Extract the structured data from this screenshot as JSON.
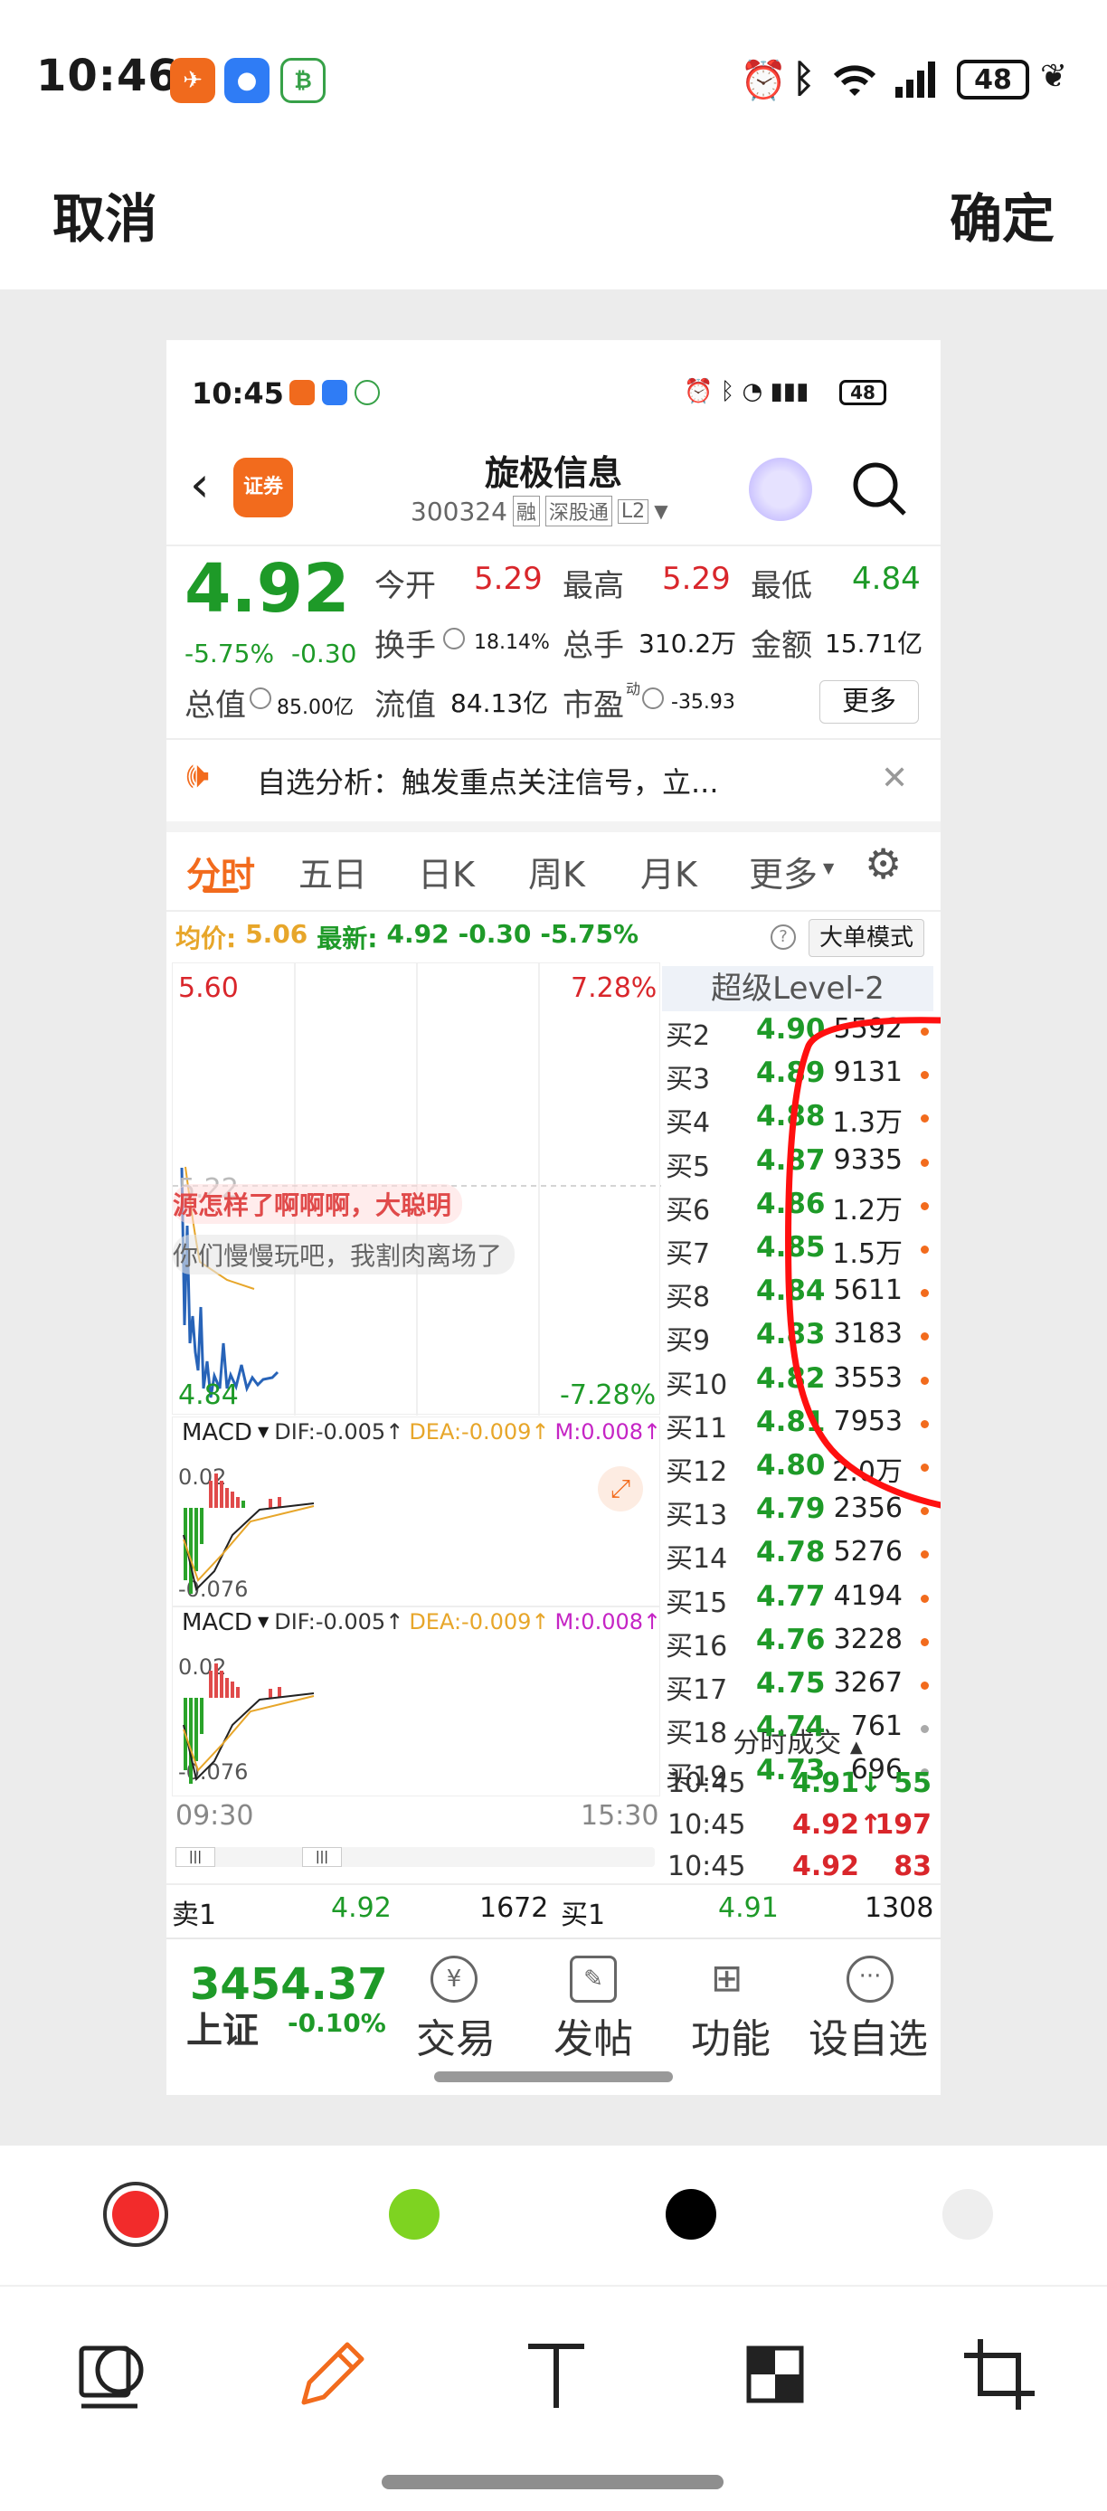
{
  "outer_status": {
    "time": "10:46",
    "battery": "48"
  },
  "editor": {
    "cancel": "取消",
    "confirm": "确定"
  },
  "phone": {
    "status": {
      "time": "10:45",
      "battery": "48"
    },
    "header": {
      "title": "旋极信息",
      "code": "300324",
      "tag_rong": "融",
      "tag_sgt": "深股通",
      "tag_l2": "L2",
      "broker_logo": "证券"
    },
    "quote": {
      "price": "4.92",
      "change_pct": "-5.75%",
      "change": "-0.30",
      "open_label": "今开",
      "open": "5.29",
      "high_label": "最高",
      "high": "5.29",
      "low_label": "最低",
      "low": "4.84",
      "turnover_label": "换手",
      "turnover": "18.14%",
      "volume_label": "总手",
      "volume": "310.2万",
      "amount_label": "金额",
      "amount": "15.71亿",
      "mcap_label": "总值",
      "mcap": "85.00亿",
      "float_label": "流值",
      "float": "84.13亿",
      "pe_label": "市盈",
      "pe_sup": "动",
      "pe": "-35.93",
      "more": "更多"
    },
    "notice": "自选分析：触发重点关注信号，立...",
    "tabs": [
      "分时",
      "五日",
      "日K",
      "周K",
      "月K",
      "更多"
    ],
    "chart_info": {
      "avg_label": "均价:",
      "avg": "5.06",
      "latest_label": "最新:",
      "latest": "4.92",
      "chg": "-0.30",
      "pct": "-5.75%",
      "bigorder": "大单模式"
    },
    "chart": {
      "top_price": "5.60",
      "top_pct": "7.28%",
      "bottom_price": "4.84",
      "bottom_pct": "-7.28%",
      "mid_price": "5.22",
      "start_time": "09:30",
      "end_time": "15:30"
    },
    "danmaku": [
      "源怎样了啊啊啊，大聪明",
      "你们慢慢玩吧，我割肉离场了"
    ],
    "macd": {
      "label": "MACD",
      "dif": "DIF:-0.005↑",
      "dea": "DEA:-0.009↑",
      "m": "M:0.008↑",
      "top": "0.02",
      "bottom": "-0.076"
    },
    "level2": {
      "title": "超级Level-2",
      "rows": [
        {
          "label": "买2",
          "price": "4.90",
          "vol": "5592"
        },
        {
          "label": "买3",
          "price": "4.89",
          "vol": "9131"
        },
        {
          "label": "买4",
          "price": "4.88",
          "vol": "1.3万"
        },
        {
          "label": "买5",
          "price": "4.87",
          "vol": "9335"
        },
        {
          "label": "买6",
          "price": "4.86",
          "vol": "1.2万"
        },
        {
          "label": "买7",
          "price": "4.85",
          "vol": "1.5万"
        },
        {
          "label": "买8",
          "price": "4.84",
          "vol": "5611"
        },
        {
          "label": "买9",
          "price": "4.83",
          "vol": "3183"
        },
        {
          "label": "买10",
          "price": "4.82",
          "vol": "3553"
        },
        {
          "label": "买11",
          "price": "4.81",
          "vol": "7953"
        },
        {
          "label": "买12",
          "price": "4.80",
          "vol": "2.0万"
        },
        {
          "label": "买13",
          "price": "4.79",
          "vol": "2356"
        },
        {
          "label": "买14",
          "price": "4.78",
          "vol": "5276"
        },
        {
          "label": "买15",
          "price": "4.77",
          "vol": "4194"
        },
        {
          "label": "买16",
          "price": "4.76",
          "vol": "3228"
        },
        {
          "label": "买17",
          "price": "4.75",
          "vol": "3267"
        },
        {
          "label": "买18",
          "price": "4.74",
          "vol": "761"
        },
        {
          "label": "买19",
          "price": "4.73",
          "vol": "696"
        }
      ],
      "trades_title": "分时成交",
      "trades": [
        {
          "time": "10:45",
          "price": "4.91↓",
          "vol": "55",
          "color": "#1e9a28"
        },
        {
          "time": "10:45",
          "price": "4.92↑",
          "vol": "197",
          "color": "#d9262b"
        },
        {
          "time": "10:45",
          "price": "4.92",
          "vol": "83",
          "color": "#d9262b"
        }
      ]
    },
    "sell1": {
      "label": "卖1",
      "price": "4.92",
      "vol": "1672"
    },
    "buy1": {
      "label": "买1",
      "price": "4.91",
      "vol": "1308"
    },
    "bottom_nav": {
      "index_value": "3454.37",
      "index_name": "上证",
      "index_pct": "-0.10%",
      "trade": "交易",
      "post": "发帖",
      "func": "功能",
      "watch": "设自选"
    }
  },
  "palette": {
    "red": "#f22b2b",
    "green": "#7ed321",
    "black": "#000000",
    "white": "#eeeeee"
  }
}
